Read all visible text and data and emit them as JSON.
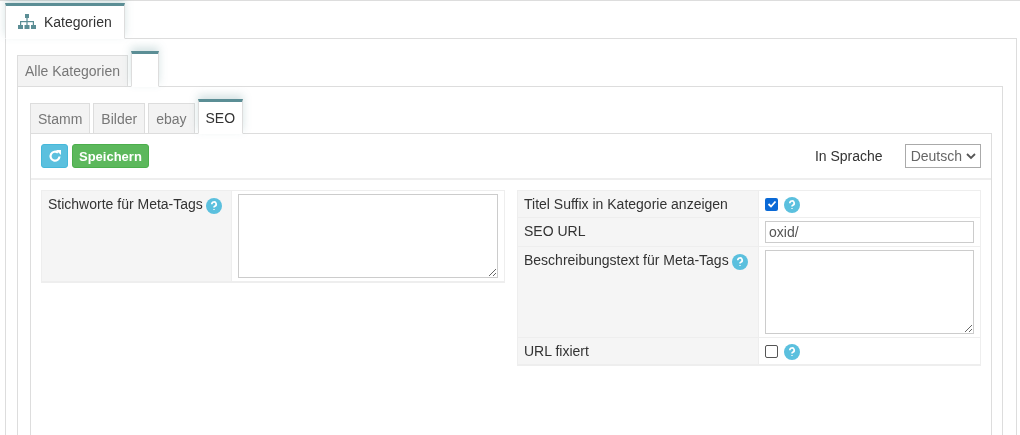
{
  "main_tab": {
    "label": "Kategorien",
    "selected": true
  },
  "category_tabs": [
    {
      "label": "Alle Kategorien",
      "selected": false
    },
    {
      "selected": true
    }
  ],
  "detail_tabs": [
    {
      "label": "Stamm",
      "selected": false
    },
    {
      "label": "Bilder",
      "selected": false
    },
    {
      "label": "ebay",
      "selected": false
    },
    {
      "label": "SEO",
      "selected": true
    }
  ],
  "toolbar": {
    "save_button": "Speichern",
    "language_label": "In Sprache",
    "language": "Deutsch"
  },
  "left_fields": [
    {
      "kind": "textarea",
      "label": "Stichworte für Meta-Tags",
      "help": true
    }
  ],
  "right_fields": [
    {
      "kind": "checkbox",
      "label": "Titel Suffix in Kategorie anzeigen",
      "checked": true,
      "help": true
    },
    {
      "kind": "text",
      "label": "SEO URL",
      "value": "oxid/",
      "help": false
    },
    {
      "kind": "textarea",
      "label": "Beschreibungstext für Meta-Tags",
      "help": true
    },
    {
      "kind": "checkbox",
      "label": "URL fixiert",
      "checked": false,
      "help": true
    }
  ]
}
